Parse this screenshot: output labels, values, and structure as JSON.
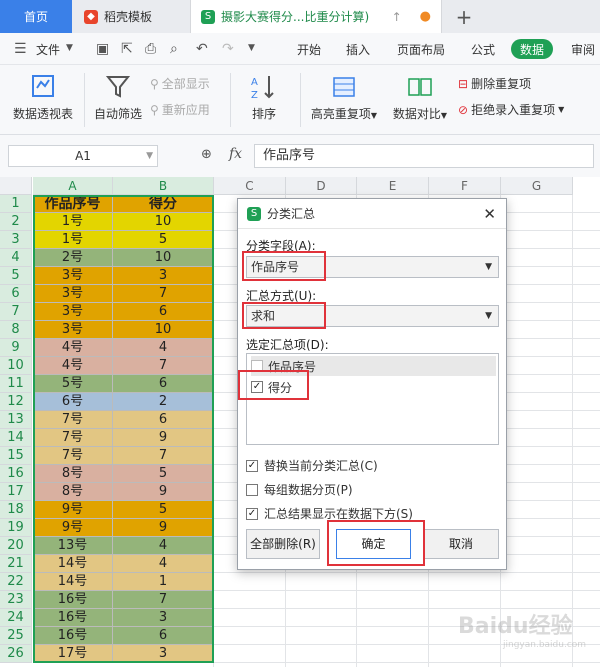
{
  "tabs": {
    "home": "首页",
    "template": "稻壳模板",
    "document": "摄影大赛得分...比重分计算)",
    "doc_actions": "↑",
    "new_tab": "+"
  },
  "menu": {
    "file": "文件",
    "items": [
      "开始",
      "插入",
      "页面布局",
      "公式",
      "数据",
      "审阅"
    ],
    "active": "数据"
  },
  "ribbon": {
    "pivot": "数据透视表",
    "autofilter": "自动筛选",
    "show_all": "全部显示",
    "reapply": "重新应用",
    "sort": "排序",
    "highlight_dup": "高亮重复项",
    "compare": "数据对比",
    "delete_dup": "删除重复项",
    "reject_dup": "拒绝录入重复项"
  },
  "formula_bar": {
    "cell_ref": "A1",
    "fx": "fx",
    "content": "作品序号"
  },
  "grid": {
    "columns": [
      "A",
      "B",
      "C",
      "D",
      "E",
      "F",
      "G"
    ],
    "header": [
      "作品序号",
      "得分"
    ],
    "rows": [
      [
        "1号",
        "10",
        "#e3d500"
      ],
      [
        "1号",
        "5",
        "#e3d500"
      ],
      [
        "2号",
        "10",
        "#94b47a"
      ],
      [
        "3号",
        "3",
        "#e0a300"
      ],
      [
        "3号",
        "7",
        "#e0a300"
      ],
      [
        "3号",
        "6",
        "#e0a300"
      ],
      [
        "3号",
        "10",
        "#e0a300"
      ],
      [
        "4号",
        "4",
        "#d9b0a0"
      ],
      [
        "4号",
        "7",
        "#d9b0a0"
      ],
      [
        "5号",
        "6",
        "#94b47a"
      ],
      [
        "6号",
        "2",
        "#a6bfd9"
      ],
      [
        "7号",
        "6",
        "#e2c683"
      ],
      [
        "7号",
        "9",
        "#e2c683"
      ],
      [
        "7号",
        "7",
        "#e2c683"
      ],
      [
        "8号",
        "5",
        "#d9b0a0"
      ],
      [
        "8号",
        "9",
        "#d9b0a0"
      ],
      [
        "9号",
        "5",
        "#e0a300"
      ],
      [
        "9号",
        "9",
        "#e0a300"
      ],
      [
        "13号",
        "4",
        "#94b47a"
      ],
      [
        "14号",
        "4",
        "#e2c683"
      ],
      [
        "14号",
        "1",
        "#e2c683"
      ],
      [
        "16号",
        "7",
        "#94b47a"
      ],
      [
        "16号",
        "3",
        "#94b47a"
      ],
      [
        "16号",
        "6",
        "#94b47a"
      ],
      [
        "17号",
        "3",
        "#e2c683"
      ]
    ],
    "header_color": "#e0a300"
  },
  "dialog": {
    "title": "分类汇总",
    "close": "✕",
    "group_field_label": "分类字段(A):",
    "group_field_value": "作品序号",
    "func_label": "汇总方式(U):",
    "func_value": "求和",
    "items_label": "选定汇总项(D):",
    "items": [
      {
        "label": "作品序号",
        "checked": false
      },
      {
        "label": "得分",
        "checked": true
      }
    ],
    "opt_replace": "替换当前分类汇总(C)",
    "opt_pagebreak": "每组数据分页(P)",
    "opt_below": "汇总结果显示在数据下方(S)",
    "btn_remove": "全部删除(R)",
    "btn_ok": "确定",
    "btn_cancel": "取消"
  },
  "watermark": "Baidu经验",
  "watermark_sub": "jingyan.baidu.com",
  "colors": {
    "accent": "#1fa055",
    "highlight": "#e0323a",
    "home_tab": "#3a80e8"
  }
}
